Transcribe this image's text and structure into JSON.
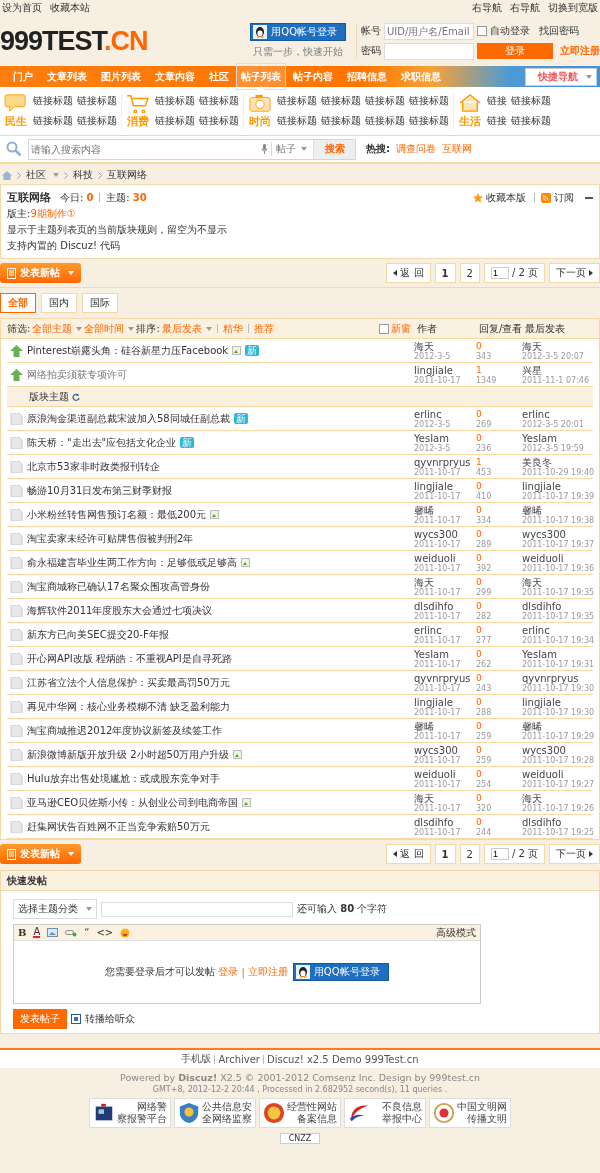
{
  "topbar": {
    "left": [
      "设为首页",
      "收藏本站"
    ],
    "right": [
      "右导航",
      "右导航",
      "切换到宽版"
    ]
  },
  "logo": {
    "main": "999TEST",
    "suffix": ".CN"
  },
  "login": {
    "qq_button": "用QQ帐号登录",
    "qq_caption": "只需一步，快速开始",
    "account_label": "帐号",
    "account_placeholder": "UID/用户名/Email",
    "auto_login": {
      "label": "自动登录",
      "checked": false
    },
    "forgot": "找回密码",
    "password_label": "密码",
    "login_button": "登录",
    "register": "立即注册"
  },
  "nav": {
    "items": [
      {
        "label": "门户",
        "selected": false
      },
      {
        "label": "文章列表",
        "selected": false
      },
      {
        "label": "图片列表",
        "selected": false
      },
      {
        "label": "文章内容",
        "selected": false
      },
      {
        "label": "社区",
        "selected": false
      },
      {
        "label": "帖子列表",
        "selected": true
      },
      {
        "label": "帖子内容",
        "selected": false
      },
      {
        "label": "招聘信息",
        "selected": false
      },
      {
        "label": "求职信息",
        "selected": false
      }
    ],
    "quick_nav": "快捷导航"
  },
  "categories": [
    {
      "kind": "chat",
      "label": "民生",
      "links": [
        "链接标题",
        "链接标题",
        "链接标题",
        "链接标题"
      ]
    },
    {
      "kind": "cart",
      "label": "消费",
      "links": [
        "链接标题",
        "链接标题",
        "链接标题",
        "链接标题"
      ]
    },
    {
      "kind": "camera",
      "label": "时尚",
      "links": [
        "链接标题",
        "链接标题",
        "链接标题",
        "链接标题",
        "链接标题",
        "链接标题",
        "链接标题",
        "链接标题"
      ]
    },
    {
      "kind": "house",
      "label": "生活",
      "links": [
        "链接",
        "链接标题",
        "链接",
        "链接标题"
      ]
    }
  ],
  "search": {
    "placeholder": "请输入搜索内容",
    "scope": "帖子",
    "button": "搜索",
    "hot_label": "热搜:",
    "hot": [
      "调查问卷",
      "互联网"
    ]
  },
  "breadcrumb": [
    "社区",
    "科技",
    "互联网络"
  ],
  "forum": {
    "title": "互联网络",
    "today_label": "今日:",
    "today": "0",
    "topics_label": "主题:",
    "topics": "30",
    "favorite": "收藏本版",
    "subscribe": "订阅",
    "moderator_label": "版主:",
    "moderator": "9期制作①",
    "rules": [
      "显示于主题列表页的当前版块规则，留空为不显示",
      "支持内置的 Discuz! 代码"
    ]
  },
  "pagers": [
    {
      "new_post_button": "发表新帖",
      "back": "返 回",
      "pages": [
        {
          "label": "1",
          "selected": true
        },
        {
          "label": "2",
          "selected": false
        }
      ],
      "page_input": "1",
      "total": "/ 2 页",
      "next": "下一页"
    },
    {
      "new_post_button": "发表新帖",
      "back": "返 回",
      "pages": [
        {
          "label": "1",
          "selected": true
        },
        {
          "label": "2",
          "selected": false
        }
      ],
      "page_input": "1",
      "total": "/ 2 页",
      "next": "下一页"
    }
  ],
  "tabs": [
    {
      "label": "全部",
      "selected": true
    },
    {
      "label": "国内",
      "selected": false
    },
    {
      "label": "国际",
      "selected": false
    }
  ],
  "filter": {
    "label": "筛选:",
    "types": "全部主题",
    "time": "全部时间",
    "sort_label": "排序:",
    "sort": "最后发表",
    "links": [
      "精华",
      "推荐"
    ],
    "new_window": {
      "label": "新窗",
      "checked": false
    },
    "columns": [
      "作者",
      "回复/查看",
      "最后发表"
    ]
  },
  "threads": [
    {
      "kind": "pinned",
      "title": "Pinterest崭露头角：硅谷新星力压Facebook",
      "image": true,
      "new": "新",
      "author": "海天",
      "date": "2012-3-5",
      "replies": "0",
      "views": "343",
      "last_user": "海天",
      "last_time": "2012-3-5 20:07"
    },
    {
      "kind": "pinned",
      "title": "网络拍卖须获专项许可",
      "image": false,
      "author": "lingjiale",
      "date": "2011-10-17",
      "replies": "1",
      "views": "1349",
      "last_user": "兴星",
      "last_time": "2011-11-1 07:46"
    },
    {
      "kind": "section",
      "title": "版块主题"
    },
    {
      "kind": "normal",
      "title": "原浪淘金渠道副总裁宋波加入58同城任副总裁",
      "image": false,
      "new": "新",
      "author": "erlinc",
      "date": "2012-3-5",
      "replies": "0",
      "views": "269",
      "last_user": "erlinc",
      "last_time": "2012-3-5 20:01"
    },
    {
      "kind": "normal",
      "title": "陈天桥：\"走出去\"应包括文化企业",
      "image": false,
      "new": "新",
      "author": "YesIam",
      "date": "2012-3-5",
      "replies": "0",
      "views": "236",
      "last_user": "YesIam",
      "last_time": "2012-3-5 19:59"
    },
    {
      "kind": "normal",
      "title": "北京市53家非时政类报刊转企",
      "image": false,
      "author": "qyvnrpryus",
      "date": "2011-10-17",
      "replies": "1",
      "views": "453",
      "last_user": "美良冬",
      "last_time": "2011-10-29 19:40"
    },
    {
      "kind": "normal",
      "title": "畅游10月31日发布第三财季财报",
      "image": false,
      "author": "lingjiale",
      "date": "2011-10-17",
      "replies": "0",
      "views": "410",
      "last_user": "lingjiale",
      "last_time": "2011-10-17 19:39"
    },
    {
      "kind": "normal",
      "title": "小米粉丝转售网售预订名额：最低200元",
      "image": true,
      "author": "馨晞",
      "date": "2011-10-17",
      "replies": "0",
      "views": "334",
      "last_user": "馨晞",
      "last_time": "2011-10-17 19:38"
    },
    {
      "kind": "normal",
      "title": "淘宝卖家未经许可贴牌售假被判刑2年",
      "image": false,
      "author": "wycs300",
      "date": "2011-10-17",
      "replies": "0",
      "views": "289",
      "last_user": "wycs300",
      "last_time": "2011-10-17 19:37"
    },
    {
      "kind": "normal",
      "title": "俞永福建言毕业生两工作方向：足够低或足够高",
      "image": true,
      "author": "weiduoli",
      "date": "2011-10-17",
      "replies": "0",
      "views": "392",
      "last_user": "weiduoli",
      "last_time": "2011-10-17 19:36"
    },
    {
      "kind": "normal",
      "title": "淘宝商城称已确认17名聚众围攻高管身份",
      "image": false,
      "author": "海天",
      "date": "2011-10-17",
      "replies": "0",
      "views": "299",
      "last_user": "海天",
      "last_time": "2011-10-17 19:35"
    },
    {
      "kind": "normal",
      "title": "海辉软件2011年度股东大会通过七项决议",
      "image": false,
      "author": "dlsdihfo",
      "date": "2011-10-17",
      "replies": "0",
      "views": "282",
      "last_user": "dlsdihfo",
      "last_time": "2011-10-17 19:35"
    },
    {
      "kind": "normal",
      "title": "新东方已向美SEC提交20-F年报",
      "image": false,
      "author": "erlinc",
      "date": "2011-10-17",
      "replies": "0",
      "views": "277",
      "last_user": "erlinc",
      "last_time": "2011-10-17 19:34"
    },
    {
      "kind": "normal",
      "title": "开心网API改版 程炳皓：不重视API是自寻死路",
      "image": false,
      "author": "YesIam",
      "date": "2011-10-17",
      "replies": "0",
      "views": "262",
      "last_user": "YesIam",
      "last_time": "2011-10-17 19:31"
    },
    {
      "kind": "normal",
      "title": "江苏省立法个人信息保护：买卖最高罚50万元",
      "image": false,
      "author": "qyvnrpryus",
      "date": "2011-10-17",
      "replies": "0",
      "views": "243",
      "last_user": "qyvnrpryus",
      "last_time": "2011-10-17 19:30"
    },
    {
      "kind": "normal",
      "title": "再见中华网：核心业务模糊不清 缺乏盈利能力",
      "image": false,
      "author": "lingjiale",
      "date": "2011-10-17",
      "replies": "0",
      "views": "288",
      "last_user": "lingjiale",
      "last_time": "2011-10-17 19:30"
    },
    {
      "kind": "normal",
      "title": "淘宝商城推迟2012年度协议新签及续签工作",
      "image": false,
      "author": "馨晞",
      "date": "2011-10-17",
      "replies": "0",
      "views": "259",
      "last_user": "馨晞",
      "last_time": "2011-10-17 19:29"
    },
    {
      "kind": "normal",
      "title": "新浪微博新版开放升级 2小时超50万用户升级",
      "image": true,
      "author": "wycs300",
      "date": "2011-10-17",
      "replies": "0",
      "views": "259",
      "last_user": "wycs300",
      "last_time": "2011-10-17 19:28"
    },
    {
      "kind": "normal",
      "title": "Hulu放弃出售处境尴尬：或成股东竞争对手",
      "image": false,
      "author": "weiduoli",
      "date": "2011-10-17",
      "replies": "0",
      "views": "254",
      "last_user": "weiduoli",
      "last_time": "2011-10-17 19:27"
    },
    {
      "kind": "normal",
      "title": "亚马逊CEO贝佐斯小传：从创业公司到电商帝国",
      "image": true,
      "author": "海天",
      "date": "2011-10-17",
      "replies": "0",
      "views": "320",
      "last_user": "海天",
      "last_time": "2011-10-17 19:26"
    },
    {
      "kind": "normal",
      "title": "赶集网状告百姓网不正当竞争索赔50万元",
      "image": false,
      "author": "dlsdihfo",
      "date": "2011-10-17",
      "replies": "0",
      "views": "244",
      "last_user": "dlsdihfo",
      "last_time": "2011-10-17 19:25"
    }
  ],
  "quick_post": {
    "title": "快速发帖",
    "category_select": "选择主题分类",
    "counter": "还可输入 **80** 个字符",
    "toolbar": [
      {
        "kind": "bold",
        "text": "B"
      },
      {
        "kind": "color",
        "text": "A"
      },
      {
        "kind": "image"
      },
      {
        "kind": "link"
      },
      {
        "kind": "quote",
        "text": "“"
      },
      {
        "kind": "code",
        "text": "<>"
      },
      {
        "kind": "smiley"
      }
    ],
    "advanced": "高级模式",
    "login_notice": "您需要登录后才可以发帖",
    "login": "登录",
    "separator": "|",
    "register": "立即注册",
    "qq_button": "用QQ帐号登录",
    "submit": "发表帖子",
    "broadcast": {
      "label": "转播给听众",
      "checked": true
    }
  },
  "footer": {
    "links": [
      "手机版",
      "Archiver",
      "Discuz! x2.5 Demo 999Test.cn"
    ],
    "powered": "Powered by **Discuz!** X2.5 © 2001-2012 Comsenz Inc. Design by 999test.cn",
    "stats": "GMT+8, 2012-12-2 20:44 , Processed in 2.682952 second(s), 11 queries .",
    "badges": [
      {
        "kind": "police",
        "lines": [
          "网络警",
          "察报警平台"
        ]
      },
      {
        "kind": "shield",
        "lines": [
          "公共信息安",
          "全网络监察"
        ]
      },
      {
        "kind": "emblem",
        "lines": [
          "经营性网站",
          "备案信息"
        ]
      },
      {
        "kind": "swoosh",
        "lines": [
          "不良信息",
          "举报中心"
        ]
      },
      {
        "kind": "flower",
        "lines": [
          "中国文明网",
          "传播文明"
        ]
      }
    ],
    "counter_badge": "CNZZ"
  }
}
